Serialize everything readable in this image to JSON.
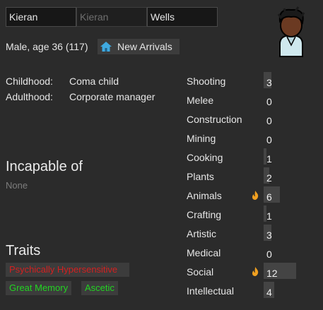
{
  "name": {
    "first": "Kieran",
    "nick_placeholder": "Kieran",
    "last": "Wells"
  },
  "description": "Male, age 36 (117)",
  "faction": {
    "label": "New Arrivals",
    "icon": "house-icon",
    "icon_color": "#3fa9e0"
  },
  "backstory": [
    {
      "key": "Childhood:",
      "value": "Coma child"
    },
    {
      "key": "Adulthood:",
      "value": "Corporate manager"
    }
  ],
  "incapable": {
    "heading": "Incapable of",
    "value": "None"
  },
  "traits": {
    "heading": "Traits",
    "items": [
      {
        "label": "Psychically Hypersensitive",
        "kind": "bad",
        "color": "#d42020"
      },
      {
        "label": "Great Memory",
        "kind": "good",
        "color": "#22d422"
      },
      {
        "label": "Ascetic",
        "kind": "good",
        "color": "#22d422"
      }
    ]
  },
  "skills": [
    {
      "name": "Shooting",
      "level": "3",
      "value": 3,
      "passion": false
    },
    {
      "name": "Melee",
      "level": "0",
      "value": 0,
      "passion": false
    },
    {
      "name": "Construction",
      "level": "0",
      "value": 0,
      "passion": false
    },
    {
      "name": "Mining",
      "level": "0",
      "value": 0,
      "passion": false
    },
    {
      "name": "Cooking",
      "level": "1",
      "value": 1,
      "passion": false
    },
    {
      "name": "Plants",
      "level": "2",
      "value": 2,
      "passion": false
    },
    {
      "name": "Animals",
      "level": "6",
      "value": 6,
      "passion": true
    },
    {
      "name": "Crafting",
      "level": "1",
      "value": 1,
      "passion": false
    },
    {
      "name": "Artistic",
      "level": "3",
      "value": 3,
      "passion": false
    },
    {
      "name": "Medical",
      "level": "0",
      "value": 0,
      "passion": false
    },
    {
      "name": "Social",
      "level": "12",
      "value": 12,
      "passion": true
    },
    {
      "name": "Intellectual",
      "level": "4",
      "value": 4,
      "passion": false
    }
  ],
  "skill_max": 20,
  "colors": {
    "background": "#2b2b2b",
    "bar": "#444444",
    "passion": "#f0a020"
  }
}
